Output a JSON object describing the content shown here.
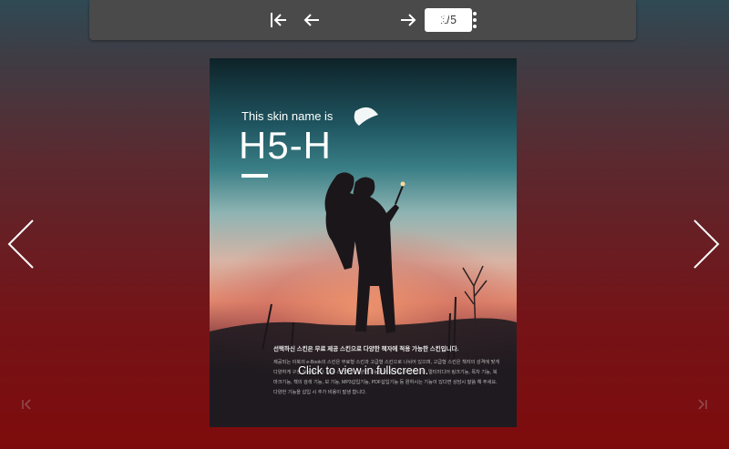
{
  "toolbar": {
    "page_indicator": "1/5",
    "buttons": [
      "first-page-icon",
      "prev-page-icon",
      "next-page-icon",
      "last-page-icon",
      "more-vertical-icon"
    ]
  },
  "book": {
    "cover_subtitle": "This skin name is",
    "cover_title": "H5-H",
    "korean_heading": "선택하신 스킨은 무료 제공 스킨으로 다양한 책자에 적용 가능한 스킨입니다.",
    "korean_body": "제공되는 이북의 e-Book의 스킨은 무료형 스킨과 고급형 스킨으로 나뉘어 있으며, 고급형 스킨은 책자의 성격에 맞게 다양하게 구성 가능합니다. 모든 스킨에는 다양한 기능을 적용시킬 수 있습니다. 멀티미디어 링크기능, 목차 기능, 북마크기능, 책의 검색 기능, 보 기능, MP3삽입기능, PDF삽입기능 등 원하시는 기능이 있다면 상담시 말씀 해 주세요. 다양한 기능을 삽입 시 추가 비용이 발생 합니다.",
    "fullscreen_hint": "Click to view in fullscreen."
  },
  "navigation": {
    "prev_arrow": "chevron-left-icon",
    "next_arrow": "chevron-right-icon",
    "corner_first": "first-page-icon",
    "corner_last": "last-page-icon"
  },
  "colors": {
    "toolbar_bg": "#4a4a4a",
    "background_top": "#2f4a55",
    "background_bottom": "#7e0b0c"
  }
}
